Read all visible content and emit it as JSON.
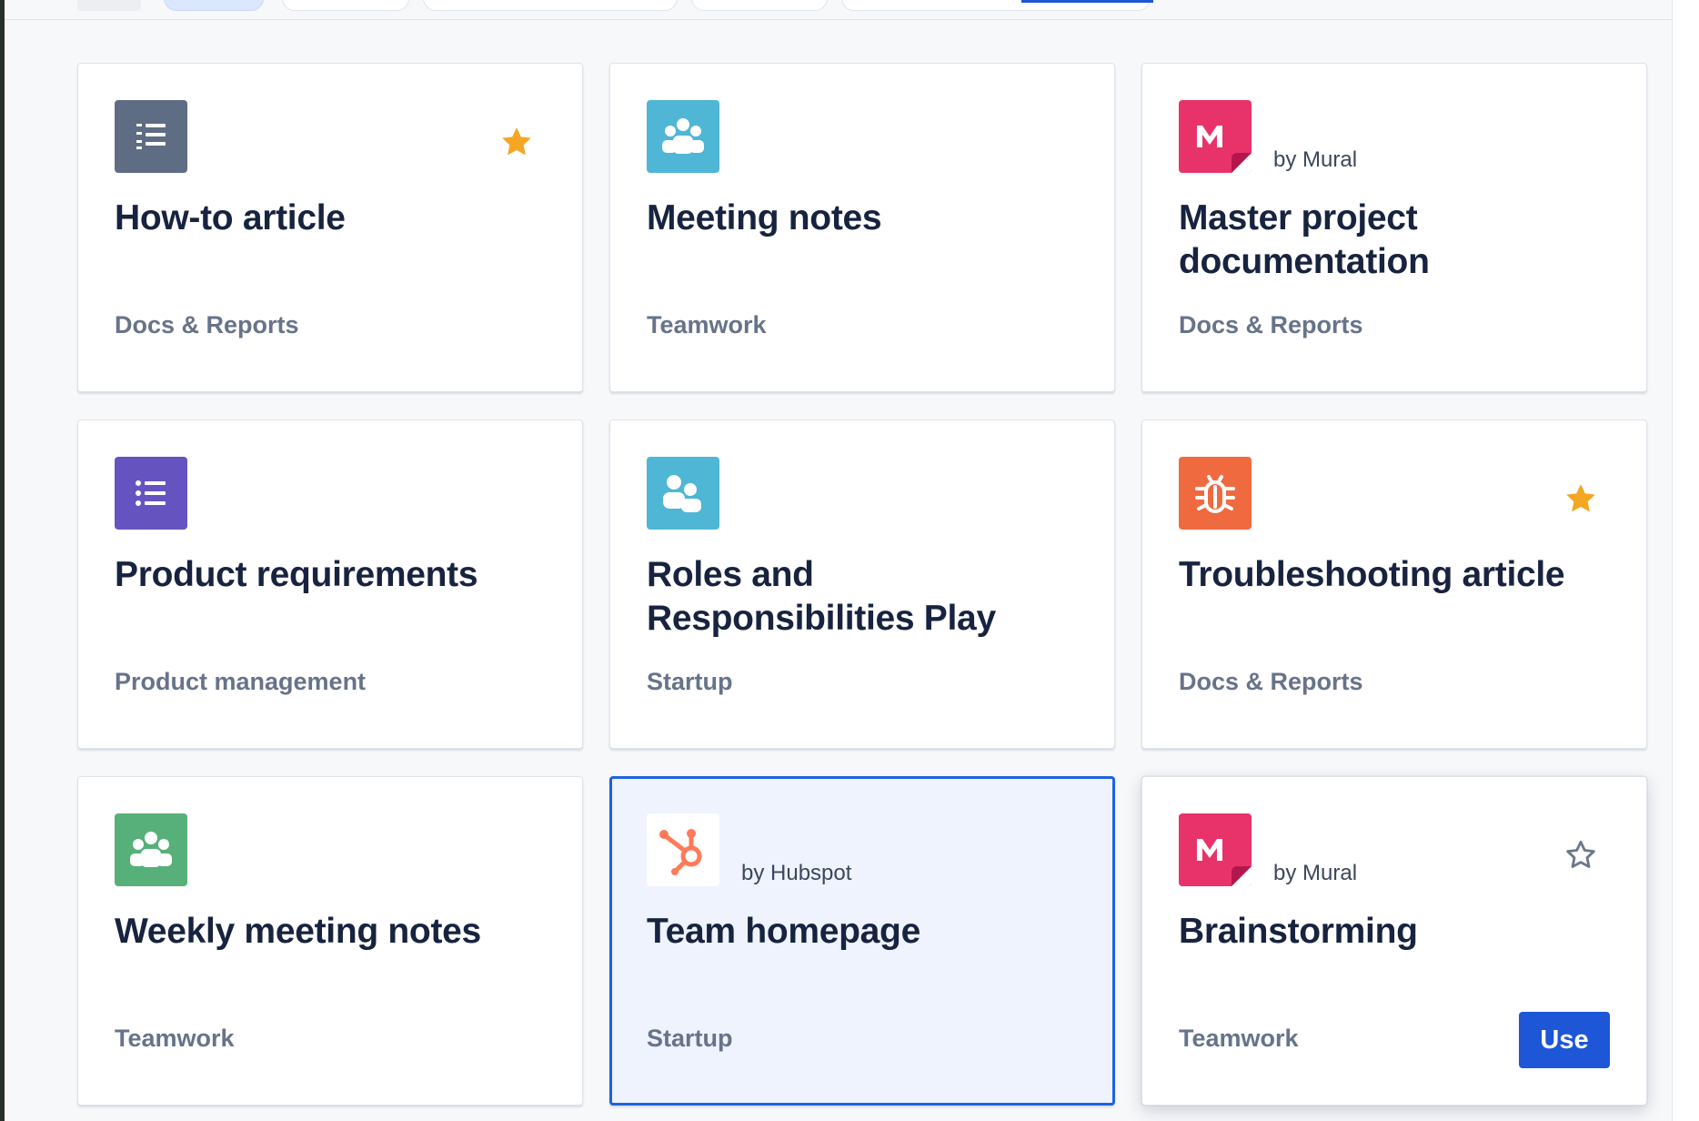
{
  "templates": [
    {
      "title": "How-to article",
      "category": "Docs & Reports",
      "byline": "",
      "icon": "numbered-list-icon",
      "icon_color": "#5e6c84",
      "starred": true
    },
    {
      "title": "Meeting notes",
      "category": "Teamwork",
      "byline": "",
      "icon": "people-group-icon",
      "icon_color": "#4fb6d6",
      "starred": false
    },
    {
      "title": "Master project documentation",
      "category": "Docs & Reports",
      "byline": "by Mural",
      "icon": "mural-logo-icon",
      "icon_color": "#e8336a",
      "starred": false
    },
    {
      "title": "Product requirements",
      "category": "Product management",
      "byline": "",
      "icon": "bullet-list-icon",
      "icon_color": "#6554c0",
      "starred": false
    },
    {
      "title": "Roles and Responsibilities Play",
      "category": "Startup",
      "byline": "",
      "icon": "people-pair-icon",
      "icon_color": "#4fb6d6",
      "starred": false
    },
    {
      "title": "Troubleshooting article",
      "category": "Docs & Reports",
      "byline": "",
      "icon": "bug-icon",
      "icon_color": "#f06a3f",
      "starred": true
    },
    {
      "title": "Weekly meeting notes",
      "category": "Teamwork",
      "byline": "",
      "icon": "people-group-icon",
      "icon_color": "#57b07a",
      "starred": false
    },
    {
      "title": "Team homepage",
      "category": "Startup",
      "byline": "by Hubspot",
      "icon": "hubspot-logo-icon",
      "icon_color": "#ff7a59",
      "starred": false,
      "selected": true
    },
    {
      "title": "Brainstorming",
      "category": "Teamwork",
      "byline": "by Mural",
      "icon": "mural-logo-icon",
      "icon_color": "#e8336a",
      "starred": false,
      "hovered": true
    }
  ],
  "actions": {
    "use_label": "Use"
  },
  "colors": {
    "star": "#f5a623",
    "accent": "#1d56d6",
    "selected_border": "#1d63e0"
  }
}
